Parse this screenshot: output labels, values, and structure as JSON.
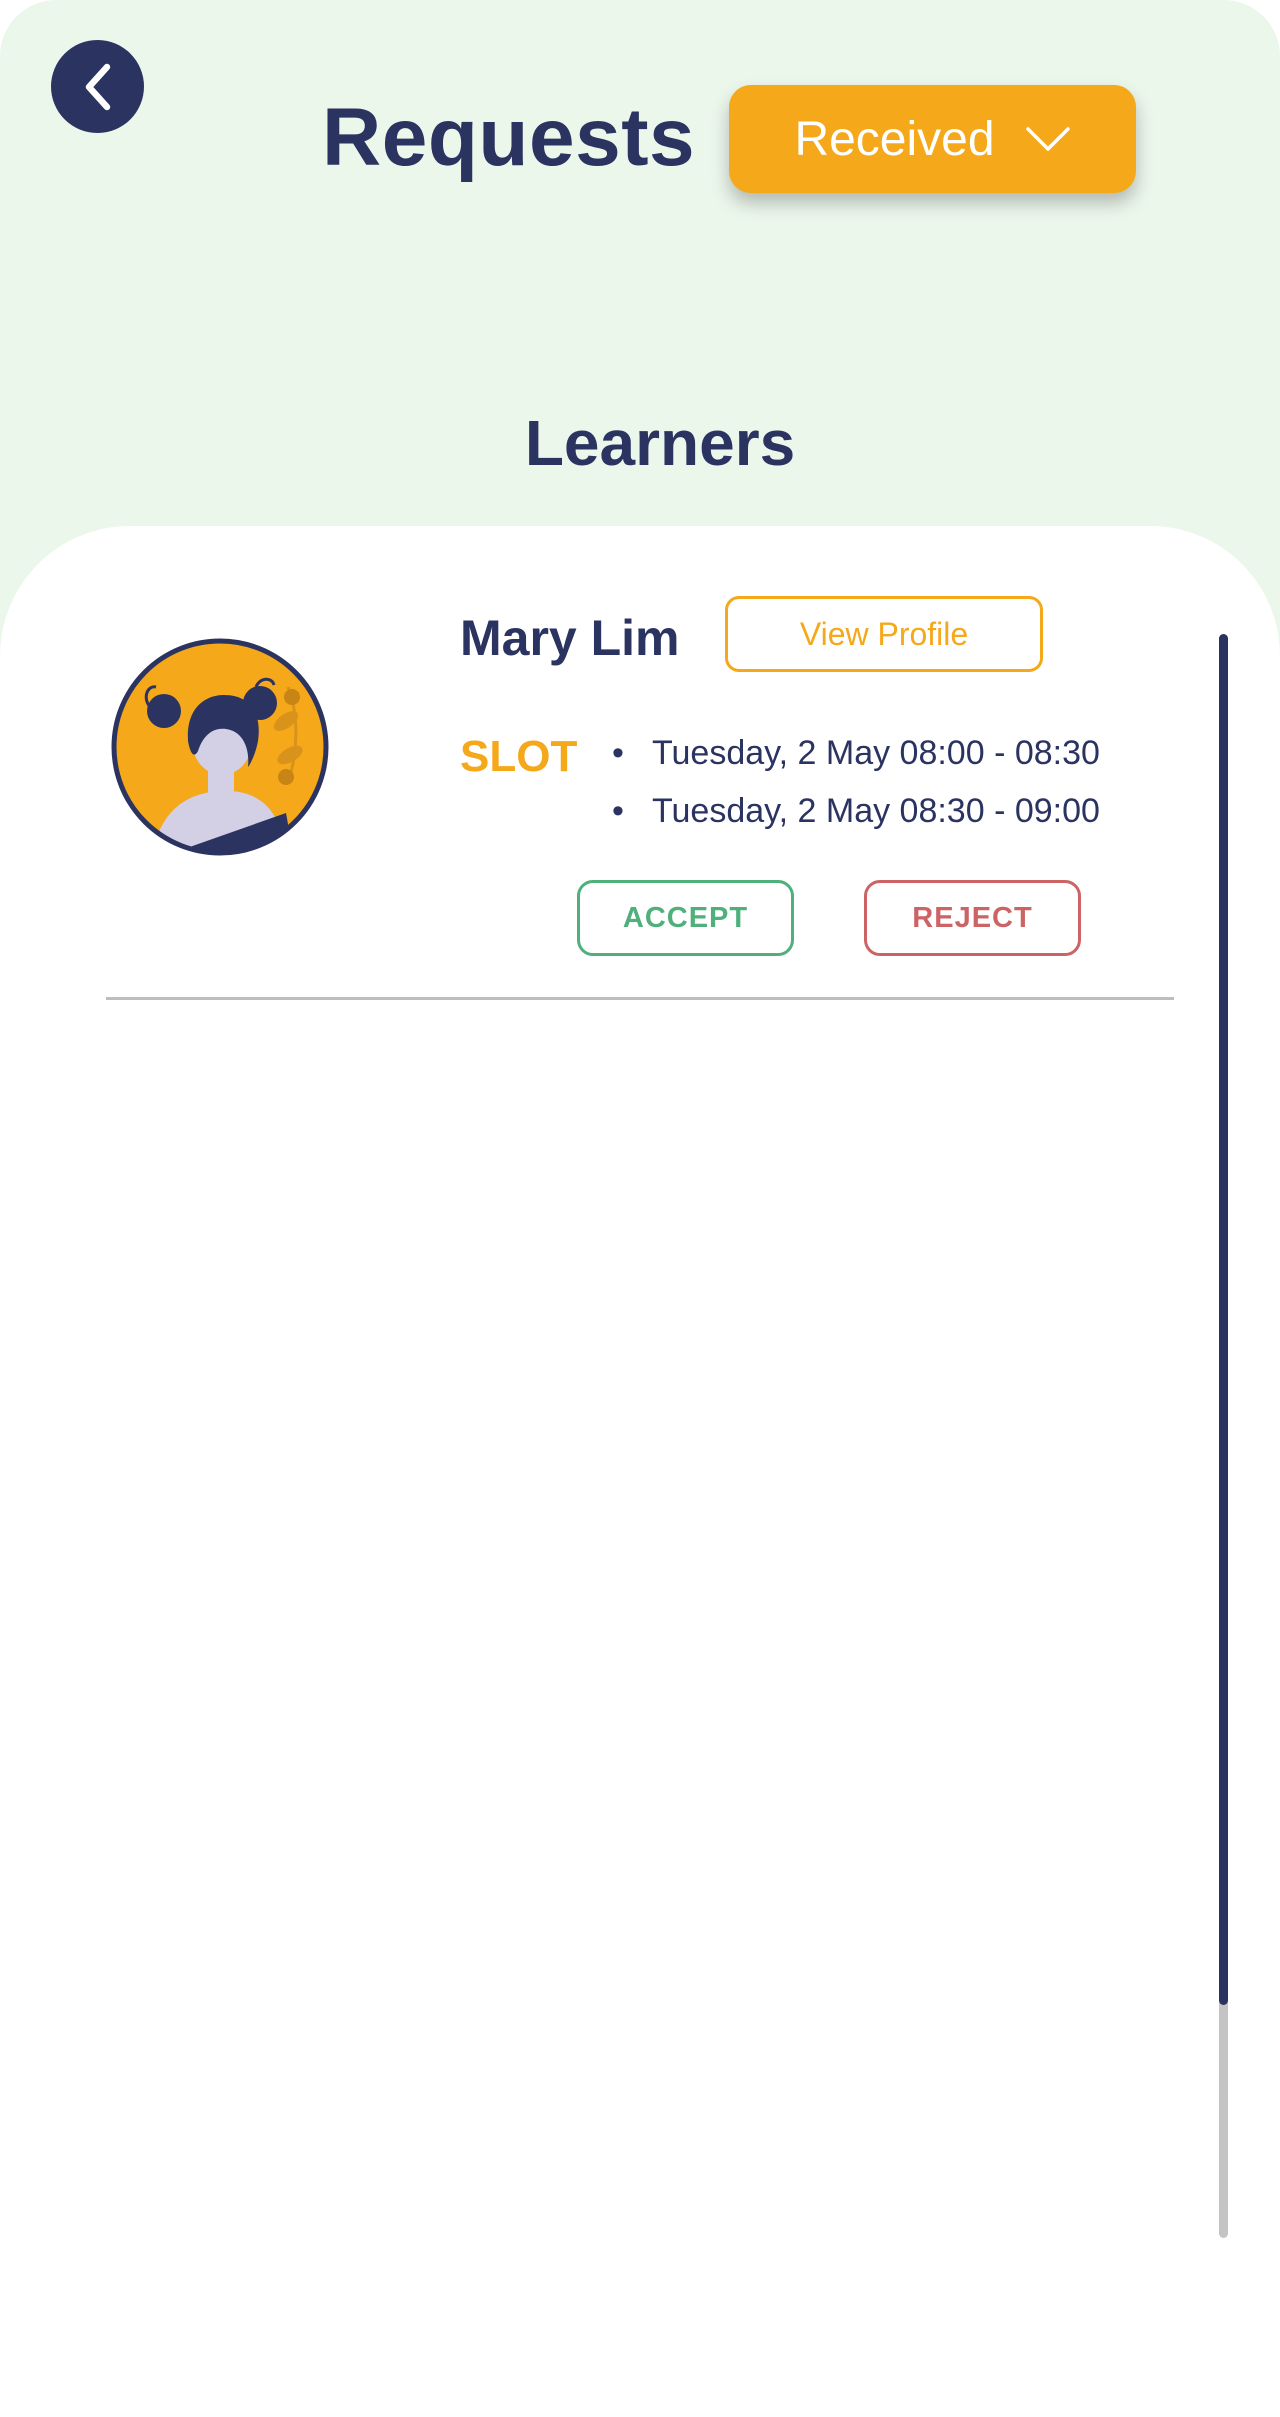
{
  "header": {
    "title": "Requests",
    "back_icon": "chevron-left-icon",
    "filter_dropdown": {
      "selected": "Received",
      "icon": "chevron-down-icon"
    }
  },
  "section": {
    "title": "Learners"
  },
  "requests": [
    {
      "name": "Mary Lim",
      "avatar_icon": "avatar-illustration",
      "view_profile_label": "View Profile",
      "slot_label": "SLOT",
      "slots": [
        "Tuesday, 2 May 08:00 - 08:30",
        "Tuesday, 2 May 08:30 - 09:00"
      ],
      "accept_label": "ACCEPT",
      "reject_label": "REJECT"
    }
  ],
  "scrollbar": {
    "position_fraction": 0.0,
    "visible_fraction": 0.855
  },
  "colors": {
    "navy": "#2b3361",
    "accent_orange": "#f4a81a",
    "header_background": "#ecf7ec",
    "accept_green": "#4fb07c",
    "reject_red": "#cc6466",
    "divider_gray": "#bdbdbd"
  }
}
